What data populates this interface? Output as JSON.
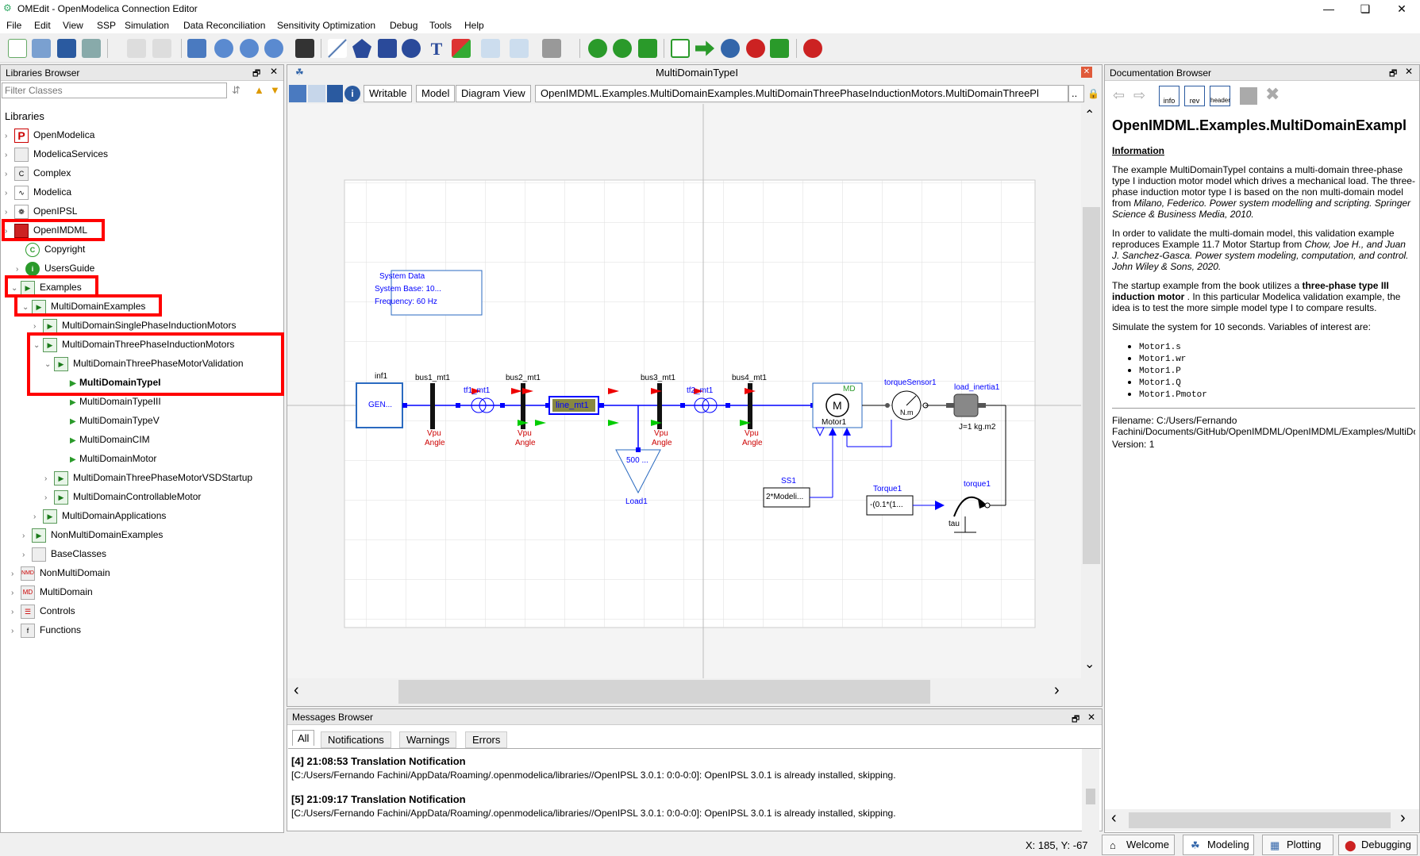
{
  "window": {
    "title": "OMEdit - OpenModelica Connection Editor",
    "min": "—",
    "max": "❏",
    "close": "✕"
  },
  "menu": [
    "File",
    "Edit",
    "View",
    "SSP",
    "Simulation",
    "Data Reconciliation",
    "Sensitivity Optimization",
    "Debug",
    "Tools",
    "Help"
  ],
  "libraries": {
    "header": "Libraries Browser",
    "filter_placeholder": "Filter Classes",
    "root": "Libraries",
    "items": [
      "OpenModelica",
      "ModelicaServices",
      "Complex",
      "Modelica",
      "OpenIPSL",
      "OpenIMDML",
      "Copyright",
      "UsersGuide",
      "Examples",
      "MultiDomainExamples",
      "MultiDomainSinglePhaseInductionMotors",
      "MultiDomainThreePhaseInductionMotors",
      "MultiDomainThreePhaseMotorValidation",
      "MultiDomainTypeI",
      "MultiDomainTypeIII",
      "MultiDomainTypeV",
      "MultiDomainCIM",
      "MultiDomainMotor",
      "MultiDomainThreePhaseMotorVSDStartup",
      "MultiDomainControllableMotor",
      "MultiDomainApplications",
      "NonMultiDomainExamples",
      "BaseClasses",
      "NonMultiDomain",
      "MultiDomain",
      "Controls",
      "Functions"
    ]
  },
  "editor": {
    "title": "MultiDomainTypeI",
    "writable": "Writable",
    "model": "Model",
    "view": "Diagram View",
    "path": "OpenIMDML.Examples.MultiDomainExamples.MultiDomainThreePhaseInductionMotors.MultiDomainThreePl",
    "more": ".."
  },
  "diagram": {
    "sysdata": [
      "System Data",
      "System Base: 10...",
      "Frequency: 60 Hz"
    ],
    "inf1": "inf1",
    "gen": "GEN...",
    "bus1": "bus1_mt1",
    "bus2": "bus2_mt1",
    "bus3": "bus3_mt1",
    "bus4": "bus4_mt1",
    "tf1": "tf1_mt1",
    "tf2": "tf2_mt1",
    "line": "line_mt1",
    "vpu": "Vpu",
    "angle": "Angle",
    "load": "Load1",
    "load_val": "500 ...",
    "md": "MD",
    "m": "M",
    "motor": "Motor1",
    "ts": "torqueSensor1",
    "nm": "N.m",
    "inertia": "load_inertia1",
    "j": "J=1 kg.m2",
    "ss1": "SS1",
    "ss1_val": "2*Modeli...",
    "torque_lbl": "Torque1",
    "torque_val": "-(0.1*(1...",
    "torque1": "torque1",
    "tau": "tau"
  },
  "messages": {
    "header": "Messages Browser",
    "tabs": [
      "All",
      "Notifications",
      "Warnings",
      "Errors"
    ],
    "entries": [
      {
        "head": "[4] 21:08:53 Translation Notification",
        "body": "[C:/Users/Fernando Fachini/AppData/Roaming/.openmodelica/libraries//OpenIPSL 3.0.1: 0:0-0:0]: OpenIPSL 3.0.1 is already installed, skipping."
      },
      {
        "head": "[5] 21:09:17 Translation Notification",
        "body": "[C:/Users/Fernando Fachini/AppData/Roaming/.openmodelica/libraries//OpenIPSL 3.0.1: 0:0-0:0]: OpenIPSL 3.0.1 is already installed, skipping."
      }
    ]
  },
  "doc": {
    "header": "Documentation Browser",
    "title": "OpenIMDML.Examples.MultiDomainExampl",
    "info_head": "Information",
    "p1a": "The example MultiDomainTypeI contains a multi-domain three-phase type I induction motor model which drives a mechanical load. The three-phase induction motor type I is based on the non multi-domain model from ",
    "p1b": "Milano, Federico. Power system modelling and scripting. Springer Science & Business Media, 2010.",
    "p2a": "In order to validate the multi-domain model, this validation example reproduces Example 11.7 Motor Startup from ",
    "p2b": "Chow, Joe H., and Juan J. Sanchez-Gasca. Power system modeling, computation, and control. John Wiley & Sons, 2020.",
    "p3a": "The startup example from the book utilizes a ",
    "p3b": "three-phase type III induction motor",
    "p3c": " . In this particular Modelica validation example, the idea is to test the more simple model type I to compare results.",
    "p4": "Simulate the system for 10 seconds. Variables of interest are:",
    "vars": [
      "Motor1.s",
      "Motor1.wr",
      "Motor1.P",
      "Motor1.Q",
      "Motor1.Pmotor"
    ],
    "filename": "Filename: C:/Users/Fernando Fachini/Documents/GitHub/OpenIMDML/OpenIMDML/Examples/MultiDom",
    "version": "Version: 1",
    "tbicons": [
      "info",
      "rev",
      "header"
    ]
  },
  "status": {
    "coords": "X: 185, Y: -67",
    "tabs": [
      "Welcome",
      "Modeling",
      "Plotting",
      "Debugging"
    ]
  },
  "colors": {
    "highlight": "#ff0000",
    "blue": "#0000ff",
    "red": "#cc0000",
    "green": "#00aa00"
  }
}
